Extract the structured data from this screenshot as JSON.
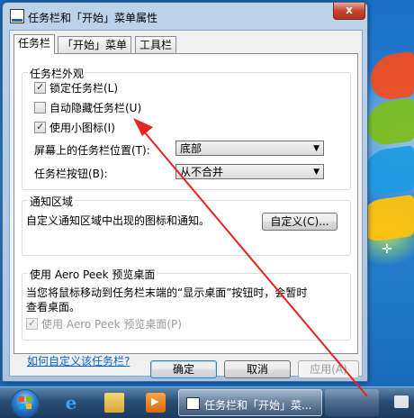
{
  "window": {
    "title": "任务栏和「开始」菜单属性",
    "close_label": "x"
  },
  "tabs": [
    {
      "label": "任务栏"
    },
    {
      "label": "「开始」菜单"
    },
    {
      "label": "工具栏"
    }
  ],
  "appearance": {
    "group_title": "任务栏外观",
    "lock_label": "锁定任务栏(L)",
    "lock_checked": true,
    "autohide_label": "自动隐藏任务栏(U)",
    "autohide_checked": false,
    "small_icons_label": "使用小图标(I)",
    "small_icons_checked": true,
    "location_label": "屏幕上的任务栏位置(T):",
    "location_value": "底部",
    "buttons_label": "任务栏按钮(B):",
    "buttons_value": "从不合并"
  },
  "notification": {
    "group_title": "通知区域",
    "description": "自定义通知区域中出现的图标和通知。",
    "customize_label": "自定义(C)..."
  },
  "aero_peek": {
    "group_title": "使用 Aero Peek 预览桌面",
    "description_line1": "当您将鼠标移动到任务栏末端的“显示桌面”按钮时，会暂时",
    "description_line2": "查看桌面。",
    "checkbox_label": "使用 Aero Peek 预览桌面(P)",
    "checkbox_checked": true
  },
  "help_link": "如何自定义该任务栏?",
  "buttons": {
    "ok": "确定",
    "cancel": "取消",
    "apply": "应用(A)"
  },
  "taskbar": {
    "active_task_label": "任务栏和「开始」菜..."
  },
  "colors": {
    "annotation_arrow": "#e8231f",
    "link": "#0066cc"
  }
}
